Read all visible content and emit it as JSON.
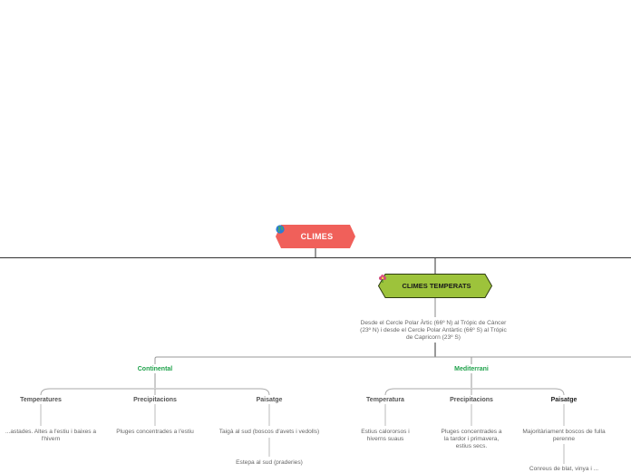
{
  "root": {
    "title": "CLIMES",
    "icon": "globe-icon",
    "color": "#f0605a"
  },
  "main_topic": {
    "title": "CLIMES TEMPERATS",
    "icon": "flower-icon",
    "color": "#9dc33b",
    "description": "Desde el Cercle Polar Àrtic (66º N) al Trópic de Càncer (23º N) i desde el Cercle Polar Antàrtic (66º S) al Trópic de Capricorn (23º S)"
  },
  "continental": {
    "title": "Continental",
    "temperatures": {
      "title": "Temperatures",
      "detail": "...astades. Altes a l'estiu i baixes a l'hivern"
    },
    "precipitacions": {
      "title": "Precipitacions",
      "detail": "Pluges concentrades a l'estiu"
    },
    "paisatge": {
      "title": "Paisatge",
      "detail": "Taigà al sud (boscos d'avets i vedolls)",
      "detail2": "Estepa al sud (praderies)"
    }
  },
  "mediterrani": {
    "title": "Mediterrani",
    "temperatura": {
      "title": "Temperatura",
      "detail": "Estius calororsos i hiverns suaus"
    },
    "precipitacions": {
      "title": "Precipitacions",
      "detail": "Pluges concentrades a la tardor i primavera, estius secs."
    },
    "paisatge": {
      "title": "Paisatge",
      "detail": "Majoritàriament boscos de fulla perenne",
      "detail2": "Conreus de blat, vinya i ..."
    }
  },
  "colors": {
    "line": "#333333",
    "branch": "#aaaaaa",
    "green_label": "#1fa24b"
  }
}
